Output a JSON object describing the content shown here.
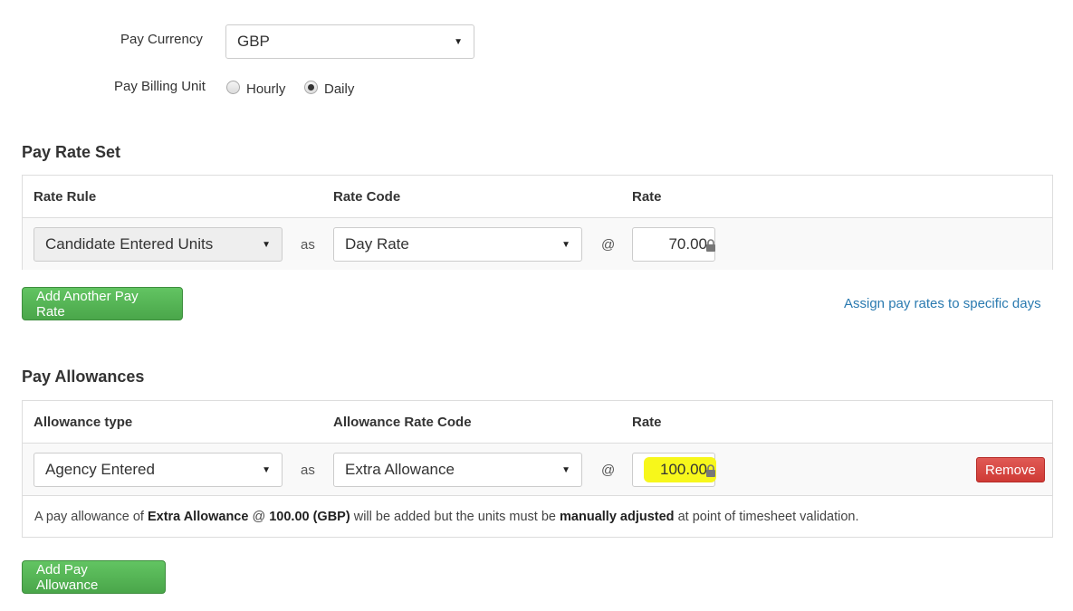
{
  "pay_currency": {
    "label": "Pay Currency",
    "value": "GBP"
  },
  "pay_billing_unit": {
    "label": "Pay Billing Unit",
    "options": [
      {
        "label": "Hourly",
        "checked": false
      },
      {
        "label": "Daily",
        "checked": true
      }
    ]
  },
  "pay_rate_set": {
    "title": "Pay Rate Set",
    "headers": {
      "rule": "Rate Rule",
      "code": "Rate Code",
      "rate": "Rate"
    },
    "row": {
      "rule": "Candidate Entered Units",
      "as": "as",
      "code": "Day Rate",
      "at": "@",
      "rate": "70.00"
    },
    "add_button": "Add Another Pay Rate",
    "assign_link": "Assign pay rates to specific days"
  },
  "pay_allowances": {
    "title": "Pay Allowances",
    "headers": {
      "type": "Allowance type",
      "code": "Allowance Rate Code",
      "rate": "Rate"
    },
    "row": {
      "type": "Agency Entered",
      "as": "as",
      "code": "Extra Allowance",
      "at": "@",
      "rate": "100.00"
    },
    "remove_button": "Remove",
    "note": {
      "prefix": "A pay allowance of ",
      "allowance": "Extra Allowance",
      "mid1": " @ ",
      "amount": "100.00 (GBP)",
      "mid2": " will be added but the units must be ",
      "emphasis": "manually adjusted",
      "suffix": " at point of timesheet validation."
    },
    "add_button": "Add Pay Allowance"
  },
  "colors": {
    "primary_button": "#5cb85c",
    "danger_button": "#d9534f",
    "link": "#2a7ab0",
    "highlight": "#f7f71b"
  }
}
